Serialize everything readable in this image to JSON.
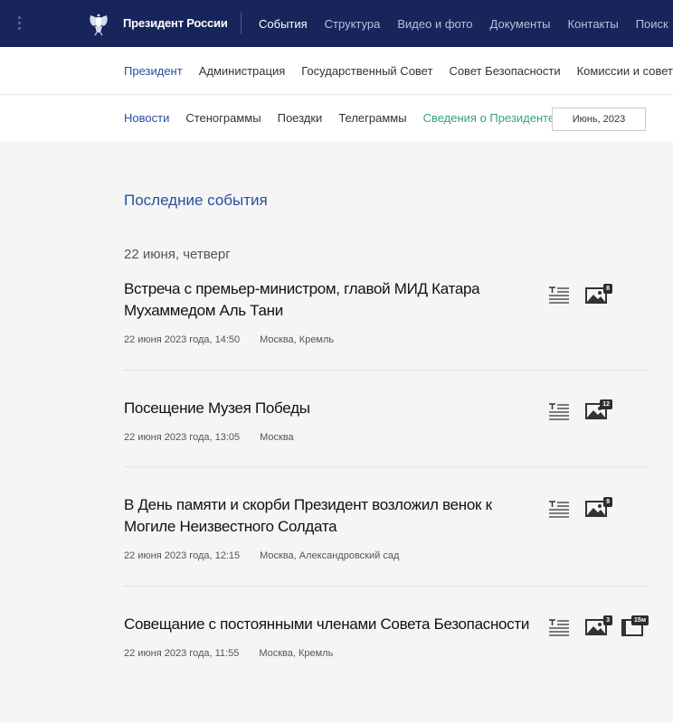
{
  "header": {
    "site_title": "Президент России",
    "nav": [
      "События",
      "Структура",
      "Видео и фото",
      "Документы",
      "Контакты",
      "Поиск"
    ]
  },
  "section_nav": [
    "Президент",
    "Администрация",
    "Государственный Совет",
    "Совет Безопасности",
    "Комиссии и советы"
  ],
  "sub_nav": [
    "Новости",
    "Стенограммы",
    "Поездки",
    "Телеграммы",
    "Сведения о Президенте"
  ],
  "date_select": "Июнь, 2023",
  "main": {
    "section_title": "Последние события",
    "day_heading": "22 июня, четверг"
  },
  "events": [
    {
      "title": "Встреча с премьер-министром, главой МИД Катара Мухаммедом Аль Тани",
      "datetime": "22 июня 2023 года, 14:50",
      "place": "Москва, Кремль",
      "photo_count": "8"
    },
    {
      "title": "Посещение Музея Победы",
      "datetime": "22 июня 2023 года, 13:05",
      "place": "Москва",
      "photo_count": "12"
    },
    {
      "title": "В День памяти и скорби Президент возложил венок к Могиле Неизвестного Солдата",
      "datetime": "22 июня 2023 года, 12:15",
      "place": "Москва, Александровский сад",
      "photo_count": "9"
    },
    {
      "title": "Совещание с постоянными членами Совета Безопасности",
      "datetime": "22 июня 2023 года, 11:55",
      "place": "Москва, Кремль",
      "photo_count": "3",
      "video_length": "15м"
    }
  ],
  "icons": {
    "menu": "vertical-dots-icon",
    "emblem": "double-headed-eagle-emblem",
    "transcript": "transcript-icon",
    "photo": "photo-icon",
    "video": "video-icon"
  },
  "colors": {
    "header_bg": "#17255a",
    "accent_blue": "#2b4da0",
    "accent_green": "#3aa07e",
    "page_bg": "#f5f5f6"
  }
}
